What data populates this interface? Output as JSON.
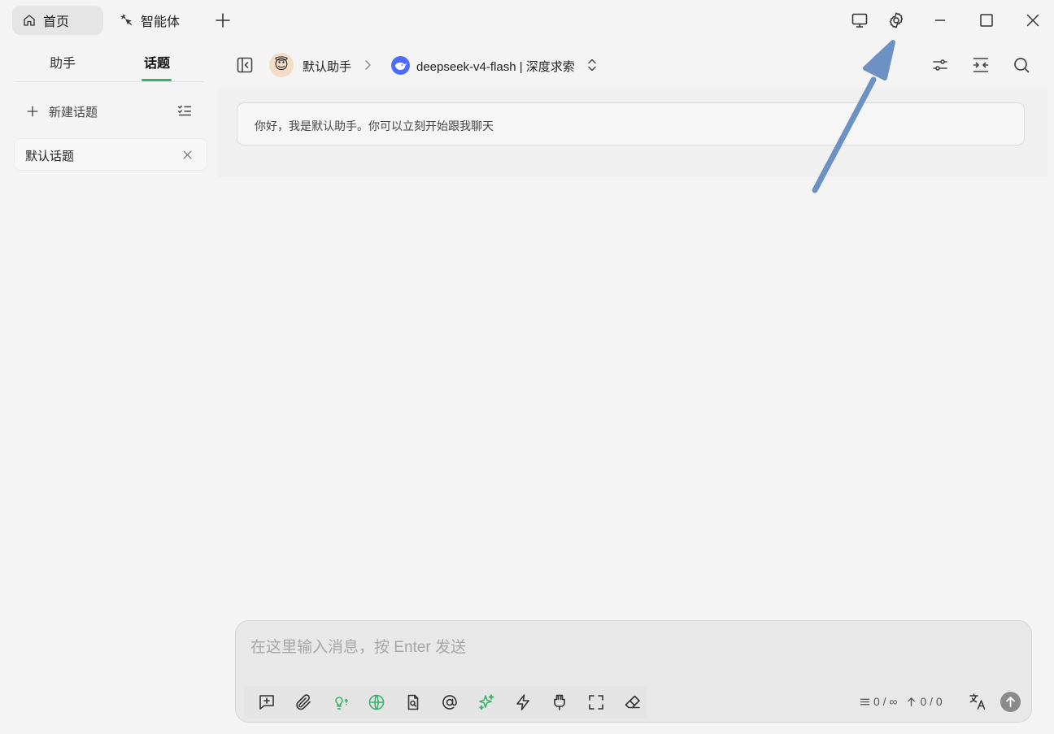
{
  "tabs": [
    {
      "label": "首页",
      "icon": "home-icon",
      "active": true
    },
    {
      "label": "智能体",
      "icon": "sparkle-cursor-icon",
      "active": false
    }
  ],
  "titlebar": {
    "add_tab_icon": "plus-icon",
    "buttons": [
      "monitor-icon",
      "settings-gear-icon",
      "minimize-icon",
      "maximize-icon",
      "close-icon"
    ]
  },
  "sidebar": {
    "segments": [
      {
        "label": "助手",
        "active": false
      },
      {
        "label": "话题",
        "active": true
      }
    ],
    "new_topic_label": "新建话题",
    "topics": [
      {
        "label": "默认话题"
      }
    ]
  },
  "header": {
    "assistant_name": "默认助手",
    "assistant_avatar": "😇",
    "model_name": "deepseek-v4-flash | 深度求索",
    "right_icons": [
      "sliders-icon",
      "narrow-mode-icon",
      "search-icon"
    ]
  },
  "chat": {
    "welcome_message": "你好，我是默认助手。你可以立刻开始跟我聊天"
  },
  "composer": {
    "placeholder": "在这里输入消息，按 Enter 发送",
    "value": "",
    "tools": [
      "new-topic-tool-icon",
      "attachment-icon",
      "thinking-icon",
      "web-search-icon",
      "knowledge-base-icon",
      "mention-icon",
      "generate-image-icon",
      "quick-phrases-icon",
      "mcp-icon",
      "fullscreen-icon",
      "clear-icon"
    ],
    "context_count": "0 / ∞",
    "token_count": "0 / 0"
  },
  "colors": {
    "accent": "#3db06a",
    "send_button": "#8a8a8a",
    "model_logo": "#4d6bfe",
    "annotation_arrow": "#6e91c4"
  }
}
